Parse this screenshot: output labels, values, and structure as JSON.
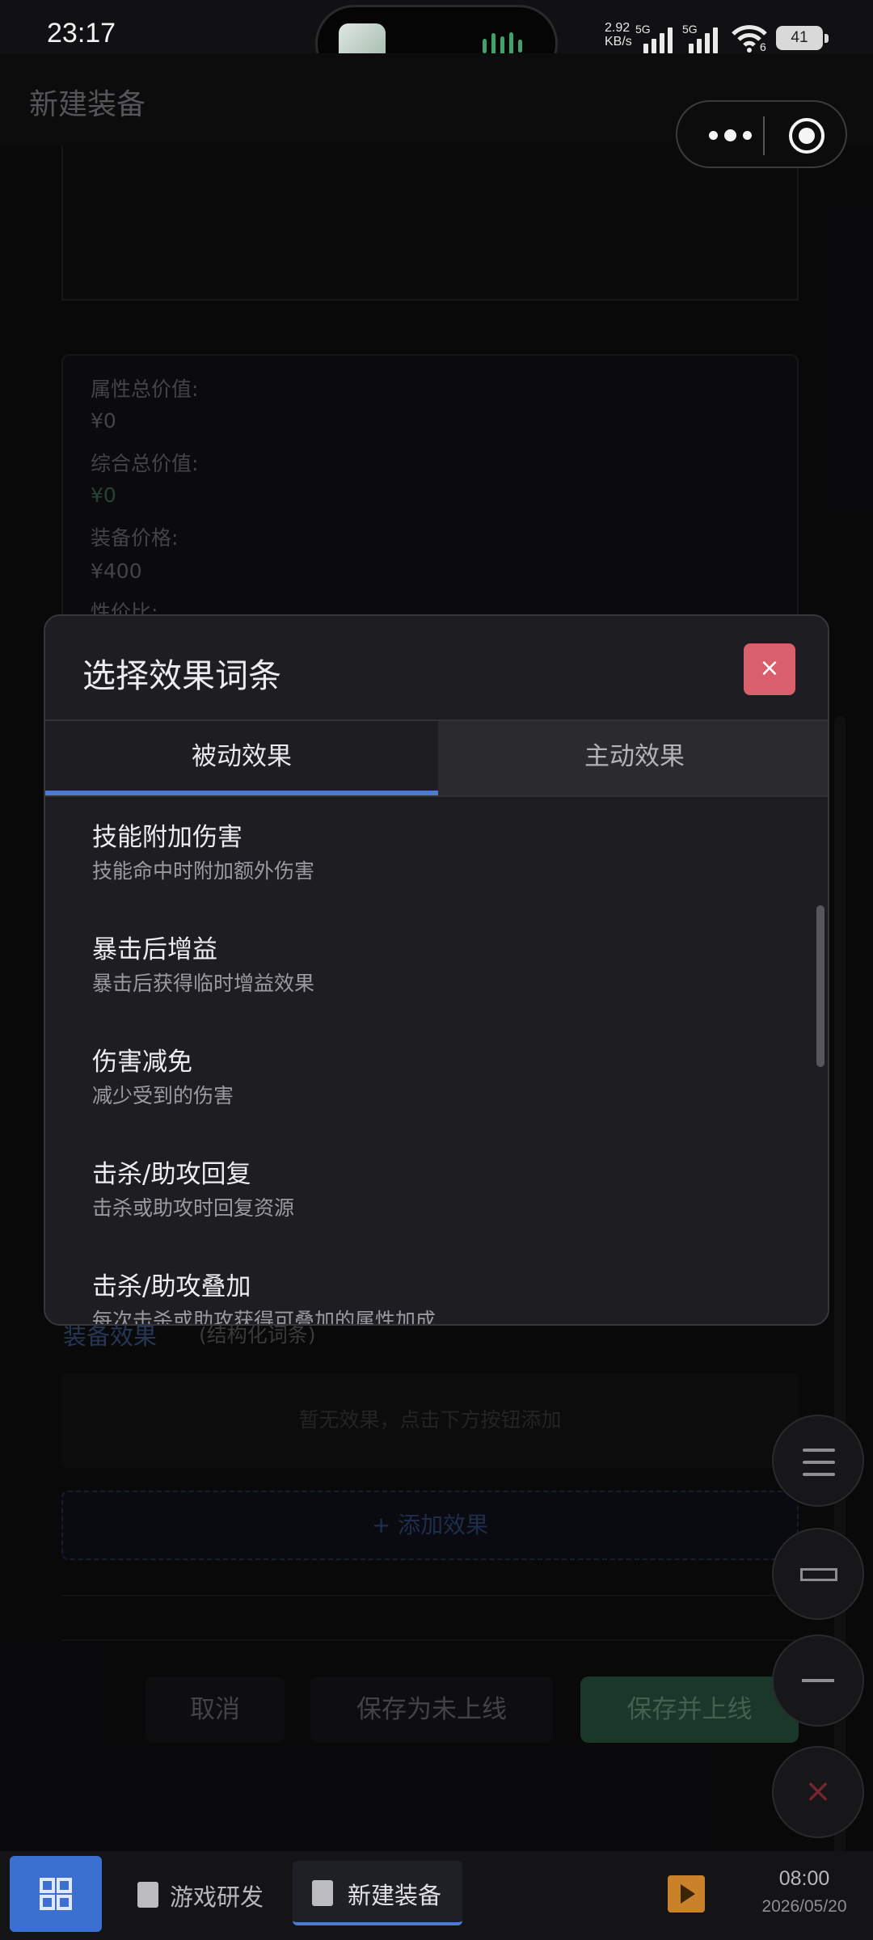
{
  "status_bar": {
    "time": "23:17",
    "net_speed_value": "2.92",
    "net_speed_unit": "KB/s",
    "signal1_label": "5G",
    "signal2_label": "5G",
    "wifi_label": "6",
    "battery": "41"
  },
  "header": {
    "title": "新建装备"
  },
  "form": {
    "summary": {
      "attr_total_label": "属性总价值:",
      "attr_total_value": "¥0",
      "overall_total_label": "综合总价值:",
      "overall_total_value": "¥0",
      "price_label": "装备价格:",
      "price_value": "¥400",
      "ratio_label": "性价比:"
    },
    "effects_heading": "装备效果",
    "effects_sub": "(结构化词条)",
    "empty_text": "暂无效果，点击下方按钮添加",
    "add_button": "+ 添加效果",
    "cancel_button": "取消",
    "save_draft_button": "保存为未上线",
    "save_online_button": "保存并上线"
  },
  "modal": {
    "title": "选择效果词条",
    "close_icon": "×",
    "tabs": [
      {
        "label": "被动效果",
        "active": true
      },
      {
        "label": "主动效果",
        "active": false
      }
    ],
    "effects": [
      {
        "name": "技能附加伤害",
        "desc": "技能命中时附加额外伤害"
      },
      {
        "name": "暴击后增益",
        "desc": "暴击后获得临时增益效果"
      },
      {
        "name": "伤害减免",
        "desc": "减少受到的伤害"
      },
      {
        "name": "击杀/助攻回复",
        "desc": "击杀或助攻时回复资源"
      },
      {
        "name": "击杀/助攻叠加",
        "desc": "每次击杀或助攻获得可叠加的属性加成"
      }
    ]
  },
  "floating_controls": {
    "close_icon": "×"
  },
  "taskbar": {
    "items": [
      {
        "label": "游戏研发",
        "active": false
      },
      {
        "label": "新建装备",
        "active": true
      }
    ],
    "clock_time": "08:00",
    "clock_date": "2026/05/20"
  },
  "colors": {
    "accent_blue": "#4d7ad6",
    "close_red": "#d95f6c",
    "save_green": "#2c5a45"
  },
  "icons": [
    "grid-icon",
    "document-icon",
    "play-icon",
    "menu-icon",
    "maximize-icon",
    "minimize-icon",
    "close-icon",
    "more-icon",
    "target-icon",
    "wifi-icon",
    "signal-icon",
    "battery-icon"
  ]
}
